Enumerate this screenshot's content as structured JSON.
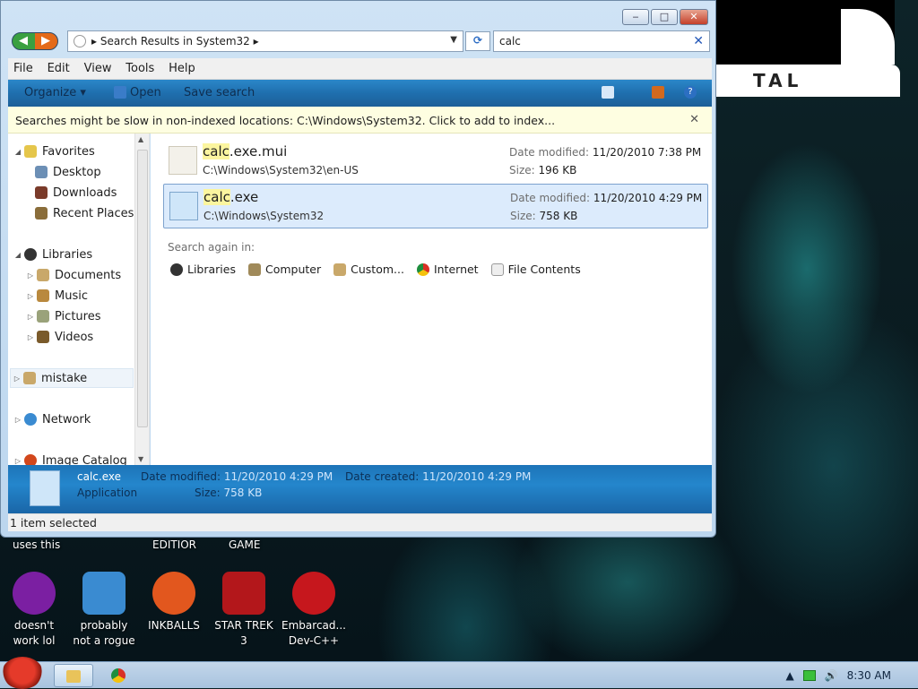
{
  "window": {
    "address": "Search Results in System32",
    "search_value": "calc",
    "controls": {
      "minimize": "‒",
      "maximize": "□",
      "close": "✕"
    }
  },
  "menu": [
    "File",
    "Edit",
    "View",
    "Tools",
    "Help"
  ],
  "toolbar": {
    "organize": "Organize ▾",
    "open": "Open",
    "save_search": "Save search"
  },
  "infobar": {
    "text": "Searches might be slow in non-indexed locations: C:\\Windows\\System32. Click to add to index..."
  },
  "nav": {
    "favorites": "Favorites",
    "desktop": "Desktop",
    "downloads": "Downloads",
    "recent": "Recent Places",
    "libraries": "Libraries",
    "documents": "Documents",
    "music": "Music",
    "pictures": "Pictures",
    "videos": "Videos",
    "mistake": "mistake",
    "network": "Network",
    "image_catalog": "Image Catalog"
  },
  "results": [
    {
      "name_hl": "calc",
      "name_rest": ".exe.mui",
      "path": "C:\\Windows\\System32\\en-US",
      "date_label": "Date modified:",
      "date": "11/20/2010 7:38 PM",
      "size_label": "Size:",
      "size": "196 KB"
    },
    {
      "name_hl": "calc",
      "name_rest": ".exe",
      "path": "C:\\Windows\\System32",
      "date_label": "Date modified:",
      "date": "11/20/2010 4:29 PM",
      "size_label": "Size:",
      "size": "758 KB"
    }
  ],
  "search_again": {
    "label": "Search again in:",
    "items": [
      "Libraries",
      "Computer",
      "Custom...",
      "Internet",
      "File Contents"
    ]
  },
  "details": {
    "name": "calc.exe",
    "type": "Application",
    "modified_label": "Date modified:",
    "modified": "11/20/2010 4:29 PM",
    "created_label": "Date created:",
    "created": "11/20/2010 4:29 PM",
    "size_label": "Size:",
    "size": "758 KB"
  },
  "status": "1 item selected",
  "desktop": {
    "banner": "TAL",
    "top_labels": [
      "uses this",
      "EDITIOR",
      "GAME"
    ],
    "icons": [
      {
        "label": "doesn't work lol",
        "color": "#7b1fa2"
      },
      {
        "label": "probably not a rogue",
        "color": "#3a8bd1"
      },
      {
        "label": "INKBALLS",
        "color": "#e2571e"
      },
      {
        "label": "STAR TREK 3",
        "color": "#b3171b"
      },
      {
        "label": "Embarcad... Dev-C++",
        "color": "#c6171d"
      }
    ]
  },
  "taskbar": {
    "clock": "8:30 AM"
  },
  "colors": {
    "accent": "#1f6fae",
    "selection": "#dcebfc",
    "highlight": "#fbf59f"
  }
}
